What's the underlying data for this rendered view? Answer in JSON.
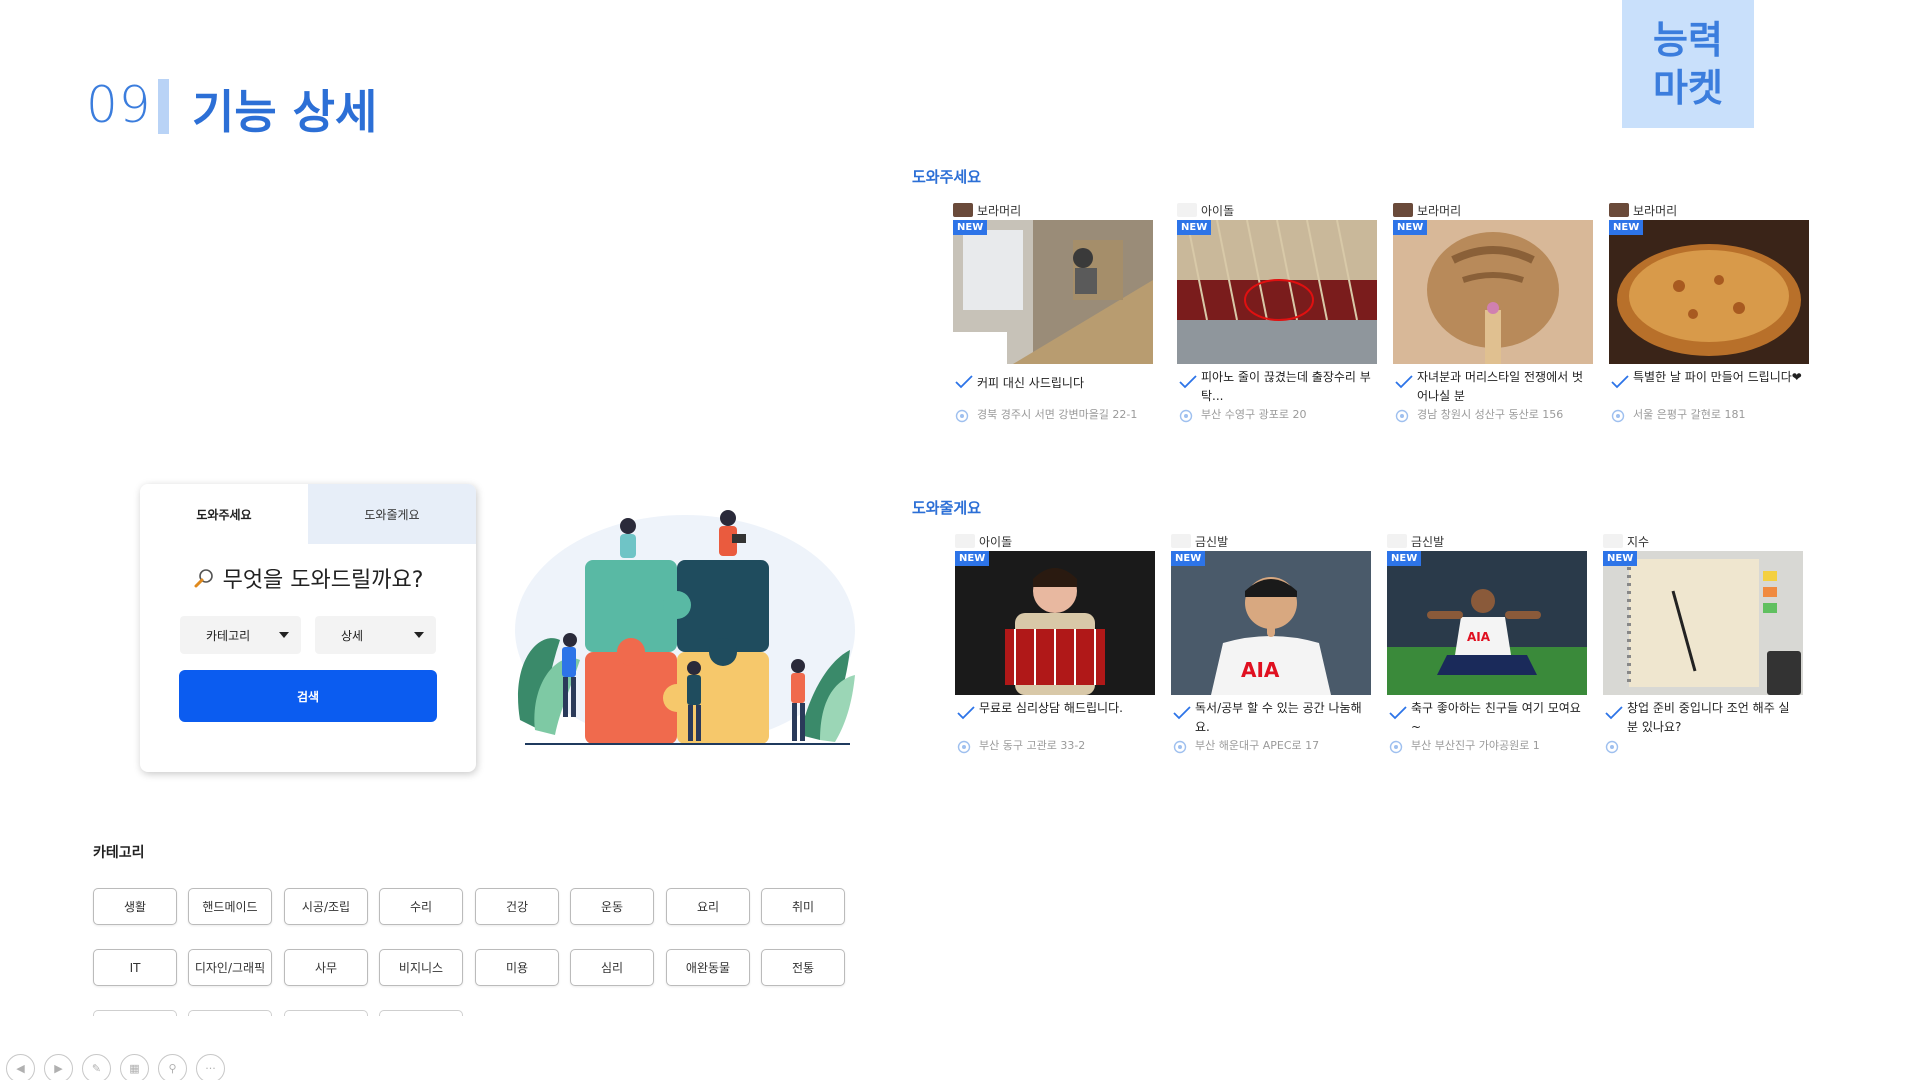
{
  "header": {
    "slide_number": "09",
    "title": "기능 상세",
    "brand_line1": "능력",
    "brand_line2": "마켓"
  },
  "search_card": {
    "tabs": [
      {
        "label": "도와주세요",
        "active": true
      },
      {
        "label": "도와줄게요",
        "active": false
      }
    ],
    "heading": "무엇을 도와드릴까요?",
    "dropdown_category": "카테고리",
    "dropdown_detail": "상세",
    "search_button": "검색"
  },
  "categories": {
    "title": "카테고리",
    "row1": [
      "생활",
      "핸드메이드",
      "시공/조립",
      "수리",
      "건강",
      "운동",
      "요리",
      "취미"
    ],
    "row2": [
      "IT",
      "디자인/그래픽",
      "사무",
      "비지니스",
      "미용",
      "심리",
      "애완동물",
      "전통"
    ]
  },
  "sections": [
    {
      "label": "도와주세요",
      "cards": [
        {
          "author": "보라머리",
          "badge": "NEW",
          "desc": "커피 대신 사드립니다",
          "location": "경북 경주시 서면 강변마을길 22-1",
          "thumb_icon": "floor-tiling-photo"
        },
        {
          "author": "아이돌",
          "badge": "NEW",
          "desc": "피아노 줄이 끊겼는데 출장수리 부탁...",
          "location": "부산 수영구 광포로 20",
          "thumb_icon": "piano-strings-photo"
        },
        {
          "author": "보라머리",
          "badge": "NEW",
          "desc": "자녀분과 머리스타일 전쟁에서 벗어나실 분",
          "location": "경남 창원시 성산구 동산로 156",
          "thumb_icon": "braided-hair-photo"
        },
        {
          "author": "보라머리",
          "badge": "NEW",
          "desc": "특별한 날 파이 만들어 드립니다❤",
          "location": "서울 은평구 갈현로 181",
          "thumb_icon": "pie-photo"
        }
      ]
    },
    {
      "label": "도와줄게요",
      "cards": [
        {
          "author": "아이돌",
          "badge": "NEW",
          "desc": "무료로 심리상담 해드립니다.",
          "location": "부산 동구 고관로 33-2",
          "thumb_icon": "accordion-player-photo"
        },
        {
          "author": "금신발",
          "badge": "NEW",
          "desc": "독서/공부 할 수 있는 공간 나눔해요.",
          "location": "부산 해운대구 APEC로 17",
          "thumb_icon": "soccer-player-shush-photo"
        },
        {
          "author": "금신발",
          "badge": "NEW",
          "desc": "축구 좋아하는 친구들 여기 모여요~",
          "location": "부산 부산진구 가야공원로 1",
          "thumb_icon": "soccer-celebration-photo"
        },
        {
          "author": "지수",
          "badge": "NEW",
          "desc": "창업 준비 중입니다 조언 해주 실 분 있나요?",
          "location": "",
          "thumb_icon": "notebook-photo"
        }
      ]
    }
  ],
  "nav": {
    "icons": [
      "prev-icon",
      "next-icon",
      "pen-icon",
      "slides-icon",
      "zoom-icon",
      "more-icon"
    ]
  },
  "colors": {
    "accent": "#2c6fd6",
    "brand_bg": "#c9e0fb",
    "button": "#0b5cf0",
    "badge": "#2d74e8"
  }
}
